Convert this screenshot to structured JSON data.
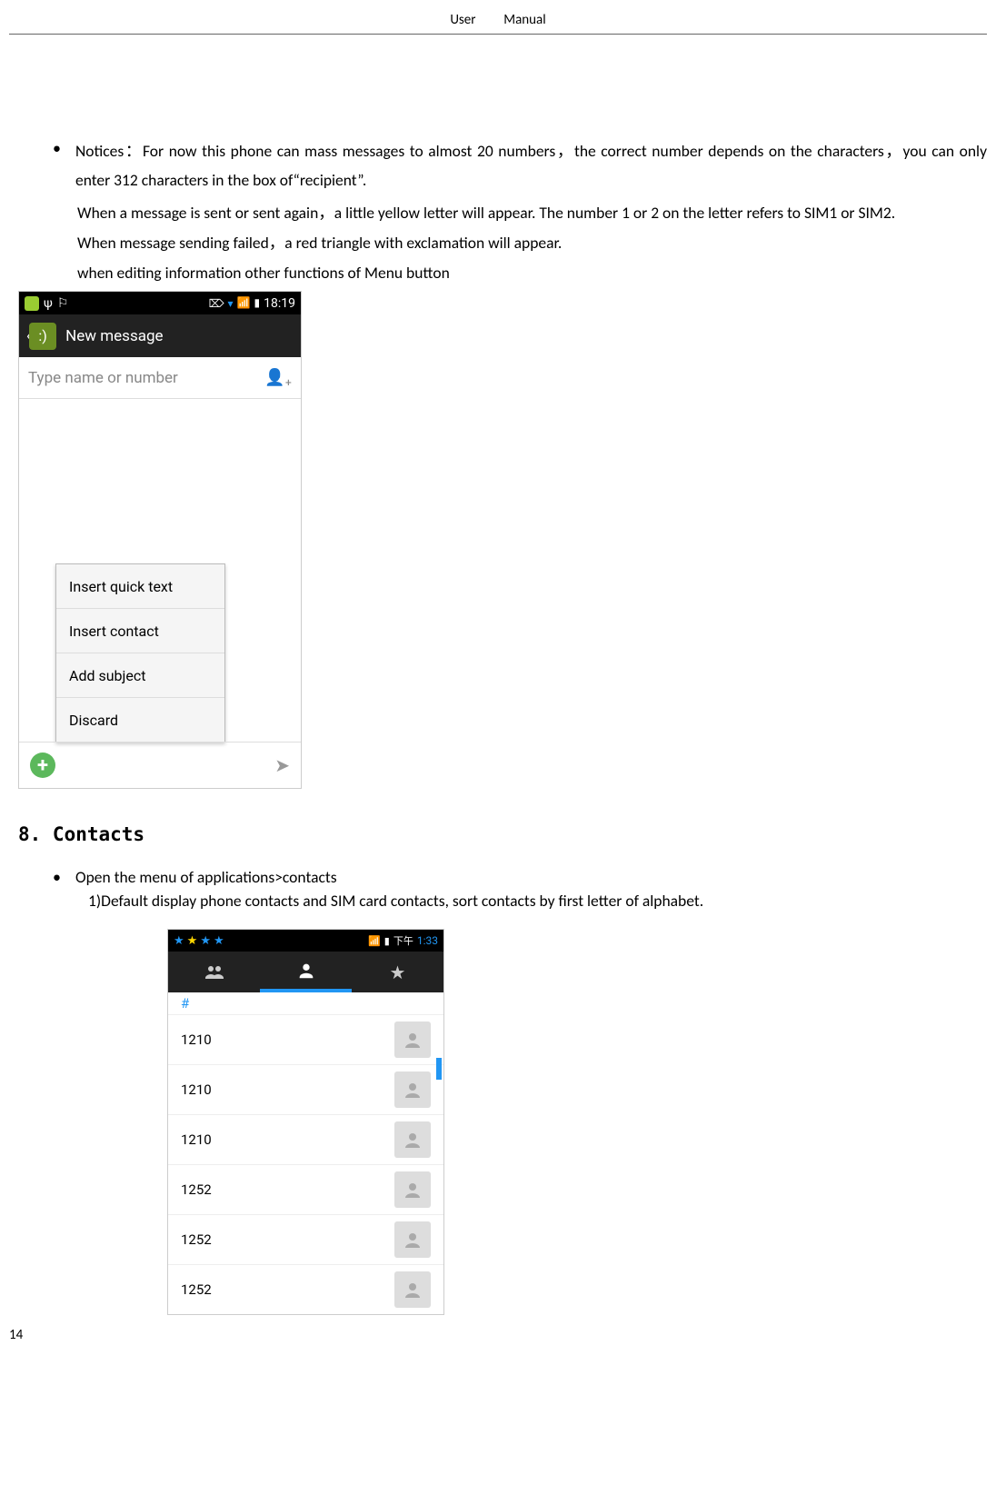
{
  "header_title": "User  Manual",
  "page_number": "14",
  "notices_label": "Notices：",
  "notices_text": "For now this phone can mass messages to almost 20 numbers，the correct number depends on the characters，you can only enter 312 characters in the box of“recipient”.",
  "paras": {
    "p1": "When a message is sent or sent again，a little yellow letter will appear. The number 1 or 2 on the letter refers to SIM1 or SIM2.",
    "p2": "When message sending failed，a red triangle with exclamation will appear.",
    "p3": "when editing information other functions of Menu button"
  },
  "screenshot1": {
    "status_time": "18:19",
    "app_title": "New message",
    "recipient_placeholder": "Type name or number",
    "menu": [
      "Insert quick text",
      "Insert contact",
      "Add subject",
      "Discard"
    ]
  },
  "section8_title": "8. Contacts",
  "contacts_bullet": "Open the menu of applications>contacts",
  "contacts_sub": "1)Default display phone contacts and SIM card contacts, sort contacts by first letter of alphabet.",
  "screenshot2": {
    "time": "1:33",
    "time_prefix": "下午",
    "hash": "#",
    "contacts": [
      "1210",
      "1210",
      "1210",
      "1252",
      "1252",
      "1252"
    ]
  }
}
